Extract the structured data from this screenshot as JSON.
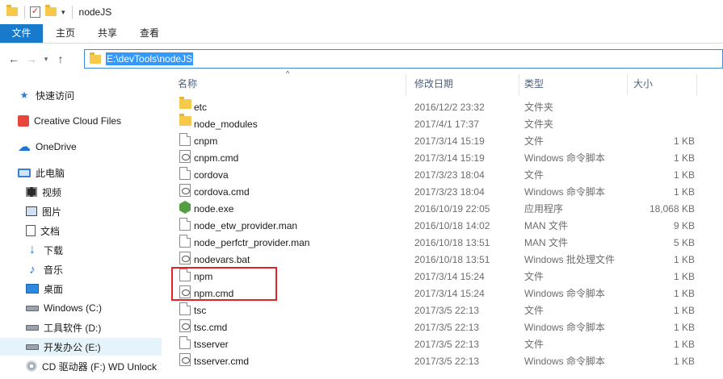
{
  "window": {
    "title": "nodeJS"
  },
  "ribbon": {
    "tabs": [
      "文件",
      "主页",
      "共享",
      "查看"
    ]
  },
  "address": {
    "path": "E:\\devTools\\nodeJS"
  },
  "columns": {
    "name": "名称",
    "date": "修改日期",
    "type": "类型",
    "size": "大小"
  },
  "sidebar": {
    "items": [
      {
        "label": "快速访问",
        "icon": "star-icon"
      },
      {
        "label": "Creative Cloud Files",
        "icon": "creative-cloud-icon"
      },
      {
        "label": "OneDrive",
        "icon": "cloud-icon"
      },
      {
        "label": "此电脑",
        "icon": "computer-icon"
      },
      {
        "label": "视频",
        "icon": "video-icon"
      },
      {
        "label": "图片",
        "icon": "pictures-icon"
      },
      {
        "label": "文档",
        "icon": "documents-icon"
      },
      {
        "label": "下载",
        "icon": "download-icon"
      },
      {
        "label": "音乐",
        "icon": "music-icon"
      },
      {
        "label": "桌面",
        "icon": "desktop-icon"
      },
      {
        "label": "Windows (C:)",
        "icon": "drive-icon"
      },
      {
        "label": "工具软件 (D:)",
        "icon": "drive-icon"
      },
      {
        "label": "开发办公 (E:)",
        "icon": "drive-icon",
        "selected": true
      },
      {
        "label": "CD 驱动器 (F:) WD Unlock",
        "icon": "cd-drive-icon"
      }
    ]
  },
  "files": [
    {
      "name": "etc",
      "date": "2016/12/2 23:32",
      "type": "文件夹",
      "size": "",
      "icon": "folder"
    },
    {
      "name": "node_modules",
      "date": "2017/4/1 17:37",
      "type": "文件夹",
      "size": "",
      "icon": "folder"
    },
    {
      "name": "cnpm",
      "date": "2017/3/14 15:19",
      "type": "文件",
      "size": "1 KB",
      "icon": "file"
    },
    {
      "name": "cnpm.cmd",
      "date": "2017/3/14 15:19",
      "type": "Windows 命令脚本",
      "size": "1 KB",
      "icon": "cmd"
    },
    {
      "name": "cordova",
      "date": "2017/3/23 18:04",
      "type": "文件",
      "size": "1 KB",
      "icon": "file"
    },
    {
      "name": "cordova.cmd",
      "date": "2017/3/23 18:04",
      "type": "Windows 命令脚本",
      "size": "1 KB",
      "icon": "cmd"
    },
    {
      "name": "node.exe",
      "date": "2016/10/19 22:05",
      "type": "应用程序",
      "size": "18,068 KB",
      "icon": "exe"
    },
    {
      "name": "node_etw_provider.man",
      "date": "2016/10/18 14:02",
      "type": "MAN 文件",
      "size": "9 KB",
      "icon": "file"
    },
    {
      "name": "node_perfctr_provider.man",
      "date": "2016/10/18 13:51",
      "type": "MAN 文件",
      "size": "5 KB",
      "icon": "file"
    },
    {
      "name": "nodevars.bat",
      "date": "2016/10/18 13:51",
      "type": "Windows 批处理文件",
      "size": "1 KB",
      "icon": "cmd"
    },
    {
      "name": "npm",
      "date": "2017/3/14 15:24",
      "type": "文件",
      "size": "1 KB",
      "icon": "file"
    },
    {
      "name": "npm.cmd",
      "date": "2017/3/14 15:24",
      "type": "Windows 命令脚本",
      "size": "1 KB",
      "icon": "cmd"
    },
    {
      "name": "tsc",
      "date": "2017/3/5 22:13",
      "type": "文件",
      "size": "1 KB",
      "icon": "file"
    },
    {
      "name": "tsc.cmd",
      "date": "2017/3/5 22:13",
      "type": "Windows 命令脚本",
      "size": "1 KB",
      "icon": "cmd"
    },
    {
      "name": "tsserver",
      "date": "2017/3/5 22:13",
      "type": "文件",
      "size": "1 KB",
      "icon": "file"
    },
    {
      "name": "tsserver.cmd",
      "date": "2017/3/5 22:13",
      "type": "Windows 命令脚本",
      "size": "1 KB",
      "icon": "cmd"
    }
  ],
  "colors": {
    "accent": "#1979ca",
    "selection": "#3399ff",
    "highlight_box": "#e0252a"
  }
}
